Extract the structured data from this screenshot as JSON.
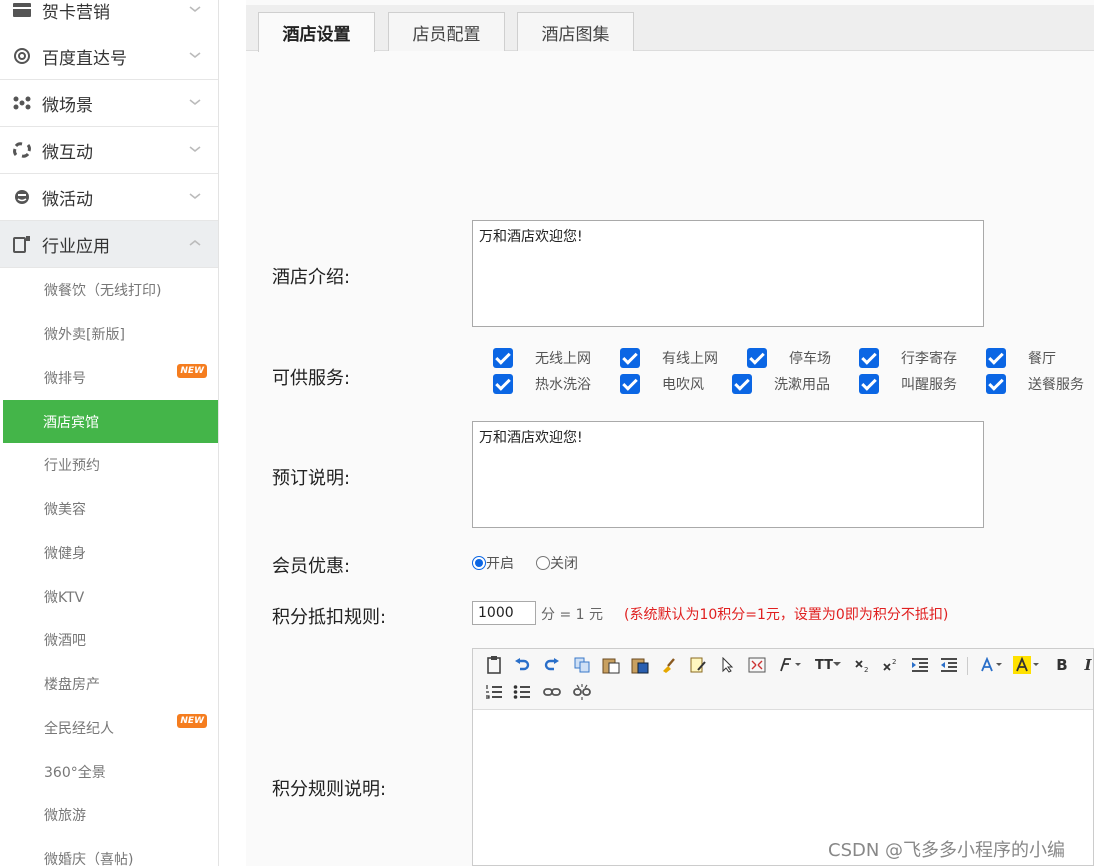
{
  "sidebar": {
    "categories": [
      {
        "label": "贺卡营销"
      },
      {
        "label": "百度直达号"
      },
      {
        "label": "微场景"
      },
      {
        "label": "微互动"
      },
      {
        "label": "微活动"
      },
      {
        "label": "行业应用"
      }
    ],
    "sub_items": [
      {
        "label": "微餐饮（无线打印)"
      },
      {
        "label": "微外卖[新版]"
      },
      {
        "label": "微排号",
        "badge": "NEW"
      },
      {
        "label": "酒店宾馆"
      },
      {
        "label": "行业预约"
      },
      {
        "label": "微美容"
      },
      {
        "label": "微健身"
      },
      {
        "label": "微KTV"
      },
      {
        "label": "微酒吧"
      },
      {
        "label": "楼盘房产"
      },
      {
        "label": "全民经纪人",
        "badge": "NEW"
      },
      {
        "label": "360°全景"
      },
      {
        "label": "微旅游"
      },
      {
        "label": "微婚庆（喜帖)"
      }
    ]
  },
  "tabs": [
    {
      "label": "酒店设置"
    },
    {
      "label": "店员配置"
    },
    {
      "label": "酒店图集"
    }
  ],
  "form": {
    "intro_label": "酒店介绍:",
    "intro_value": "万和酒店欢迎您!",
    "services_label": "可供服务:",
    "services": [
      {
        "label": "无线上网"
      },
      {
        "label": "有线上网"
      },
      {
        "label": "停车场"
      },
      {
        "label": "行李寄存"
      },
      {
        "label": "餐厅"
      },
      {
        "label": "热水洗浴"
      },
      {
        "label": "电吹风"
      },
      {
        "label": "洗漱用品"
      },
      {
        "label": "叫醒服务"
      },
      {
        "label": "送餐服务"
      }
    ],
    "booking_label": "预订说明:",
    "booking_value": "万和酒店欢迎您!",
    "member_label": "会员优惠:",
    "member_on": "开启",
    "member_off": "关闭",
    "points_label": "积分抵扣规则:",
    "points_value": "1000",
    "points_unit": "分 = 1 元",
    "points_note": "(系统默认为10积分=1元，设置为0即为积分不抵扣)",
    "rules_label": "积分规则说明:"
  },
  "editor": {
    "font_size_btn": "TT",
    "bold_btn": "B",
    "italic_btn": "I"
  },
  "watermark": "CSDN @飞多多小程序的小编",
  "colors": {
    "accent": "#44b549",
    "checkbox": "#0b66e4",
    "note": "#e02020"
  }
}
